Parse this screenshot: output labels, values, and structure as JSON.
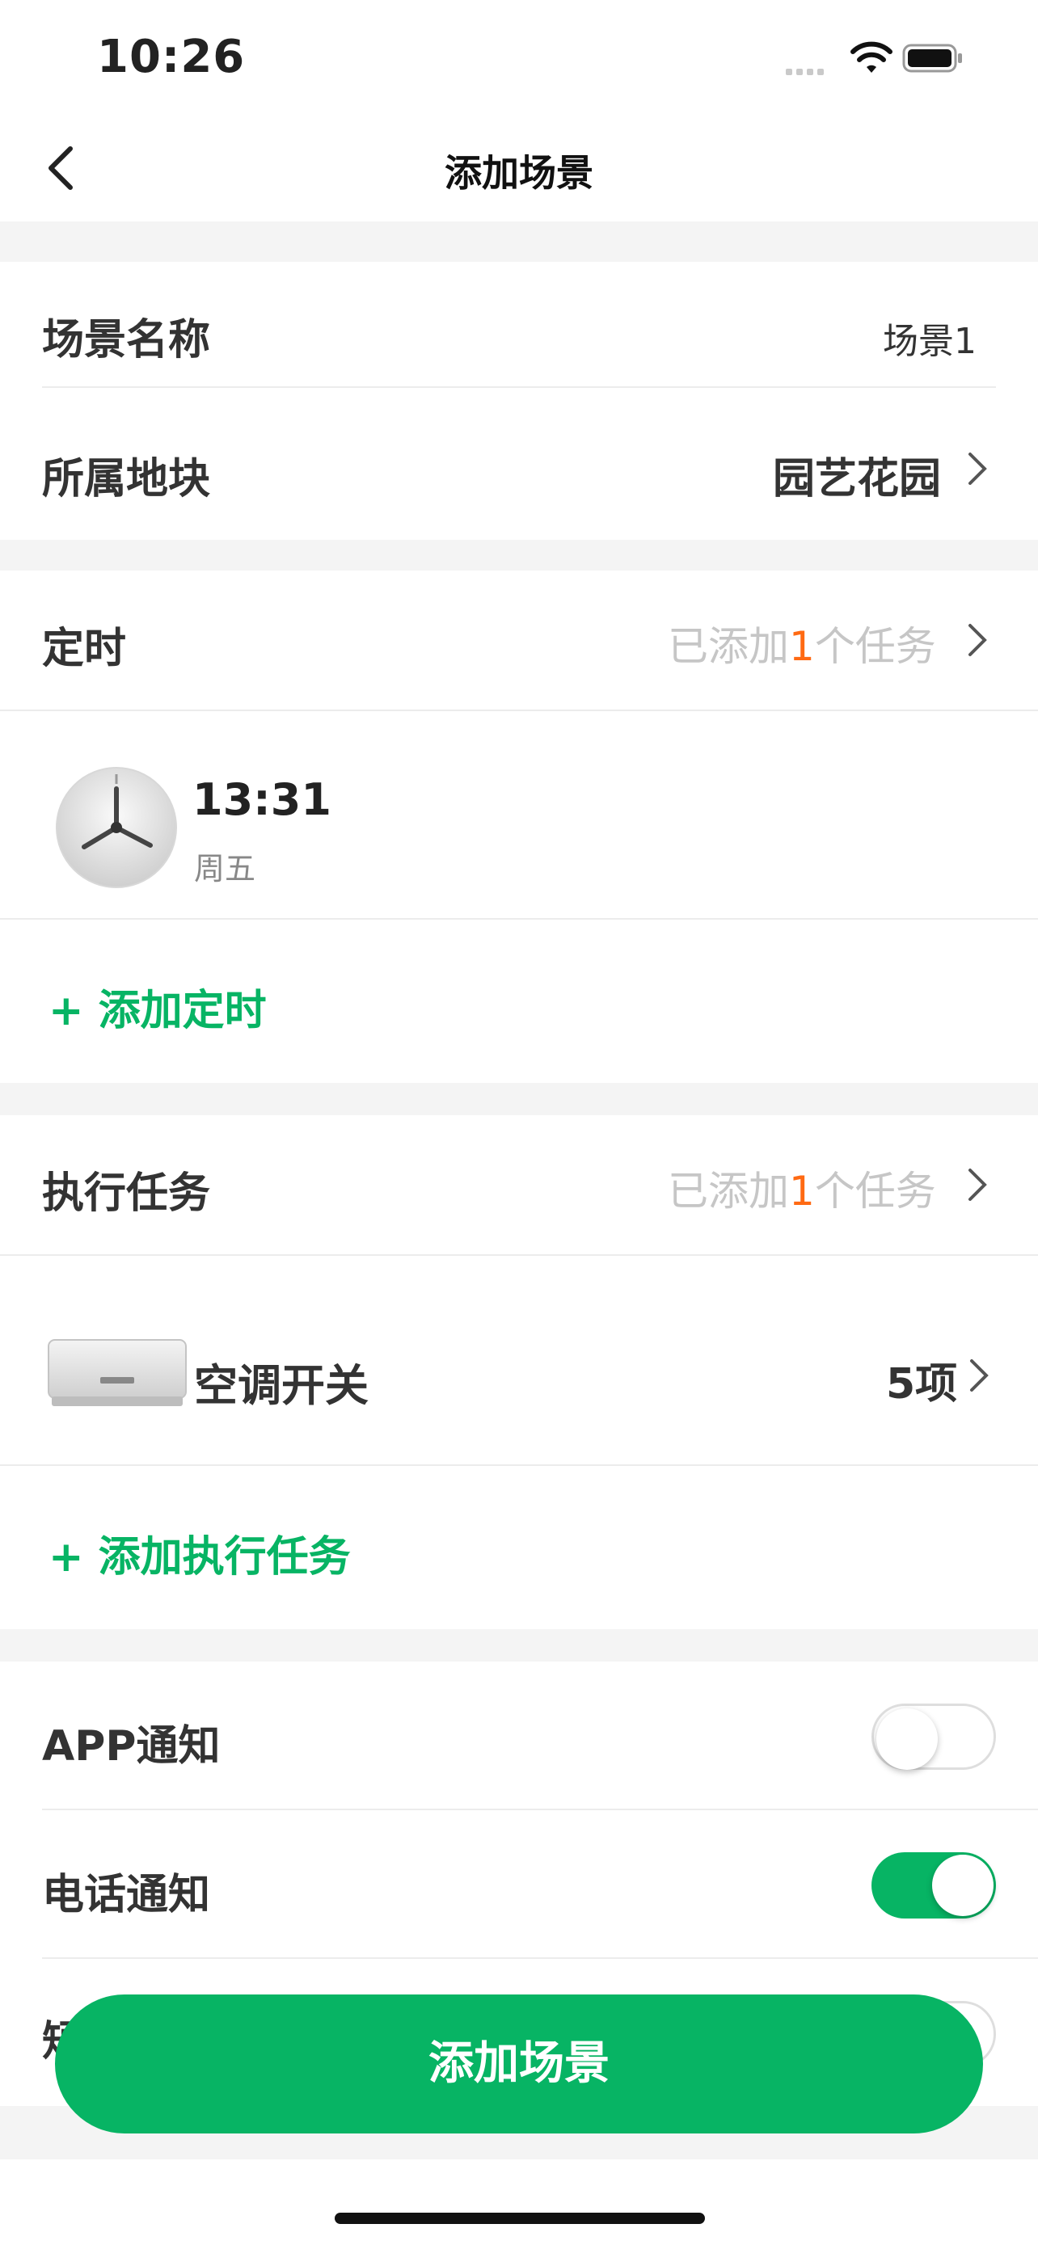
{
  "status": {
    "time": "10:26"
  },
  "nav": {
    "title": "添加场景"
  },
  "info": {
    "name_label": "场景名称",
    "name_value": "场景1",
    "plot_label": "所属地块",
    "plot_value": "园艺花园"
  },
  "timer": {
    "label": "定时",
    "count_prefix": "已添加",
    "count": "1",
    "count_suffix": "个任务",
    "item_time": "13:31",
    "item_day": "周五",
    "add_label": "+ 添加定时"
  },
  "tasks": {
    "label": "执行任务",
    "count_prefix": "已添加",
    "count": "1",
    "count_suffix": "个任务",
    "item_name": "空调开关",
    "item_count": "5项",
    "add_label": "+ 添加执行任务"
  },
  "notify": {
    "app_label": "APP通知",
    "app_on": false,
    "phone_label": "电话通知",
    "phone_on": true,
    "sms_label_partial": "短"
  },
  "footer": {
    "button_label": "添加场景"
  },
  "colors": {
    "accent": "#07b464",
    "highlight": "#ff6a13"
  }
}
